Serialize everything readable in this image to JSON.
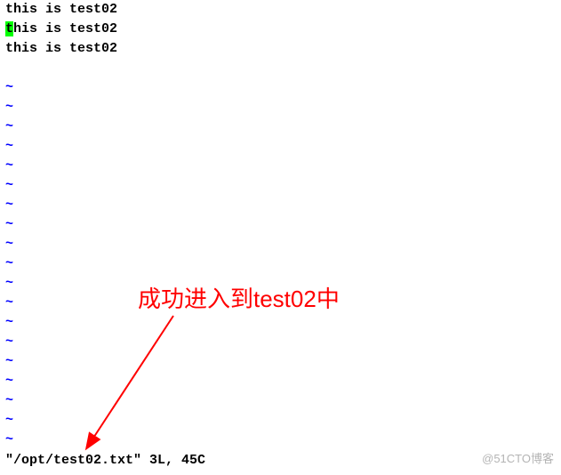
{
  "editor": {
    "lines": [
      "this is test02",
      "this is test02",
      "this is test02"
    ],
    "cursor_line": 1,
    "cursor_col": 0,
    "tilde": "~"
  },
  "status_line": "\"/opt/test02.txt\" 3L, 45C",
  "annotation": "成功进入到test02中",
  "watermark": "@51CTO博客"
}
